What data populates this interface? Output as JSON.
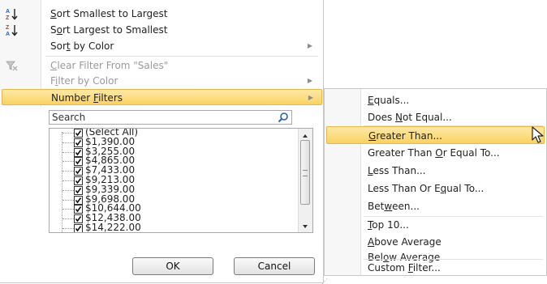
{
  "menu": {
    "sort_asc": {
      "pre": "",
      "ul": "S",
      "post": "ort Smallest to Largest"
    },
    "sort_desc": {
      "pre": "S",
      "ul": "o",
      "post": "rt Largest to Smallest"
    },
    "sort_color": {
      "pre": "Sor",
      "ul": "t",
      "post": " by Color"
    },
    "clear_filter": {
      "pre": "",
      "ul": "C",
      "post": "lear Filter From \"Sales\""
    },
    "filter_color": {
      "pre": "F",
      "ul": "i",
      "post": "lter by Color"
    },
    "number_filters": {
      "pre": "Number ",
      "ul": "F",
      "post": "ilters"
    }
  },
  "search": {
    "placeholder": "Search",
    "value": ""
  },
  "checklist": {
    "items": [
      {
        "label": "(Select All)",
        "checked": true
      },
      {
        "label": "$1,390.00",
        "checked": true
      },
      {
        "label": "$3,255.00",
        "checked": true
      },
      {
        "label": "$4,865.00",
        "checked": true
      },
      {
        "label": "$7,433.00",
        "checked": true
      },
      {
        "label": "$9,213.00",
        "checked": true
      },
      {
        "label": "$9,339.00",
        "checked": true
      },
      {
        "label": "$9,698.00",
        "checked": true
      },
      {
        "label": "$10,644.00",
        "checked": true
      },
      {
        "label": "$12,438.00",
        "checked": true
      },
      {
        "label": "$14,222.00",
        "checked": true
      }
    ]
  },
  "buttons": {
    "ok": "OK",
    "cancel": "Cancel"
  },
  "submenu": {
    "equals": {
      "pre": "",
      "ul": "E",
      "post": "quals..."
    },
    "not_equal": {
      "pre": "Does ",
      "ul": "N",
      "post": "ot Equal..."
    },
    "greater_than": {
      "pre": "",
      "ul": "G",
      "post": "reater Than..."
    },
    "greater_equal": {
      "pre": "Greater Than ",
      "ul": "O",
      "post": "r Equal To..."
    },
    "less_than": {
      "pre": "",
      "ul": "L",
      "post": "ess Than..."
    },
    "less_equal": {
      "pre": "Less Than Or E",
      "ul": "q",
      "post": "ual To..."
    },
    "between": {
      "pre": "Bet",
      "ul": "w",
      "post": "een..."
    },
    "top10": {
      "pre": "",
      "ul": "T",
      "post": "op 10..."
    },
    "above_avg": {
      "pre": "",
      "ul": "A",
      "post": "bove Average"
    },
    "below_avg": {
      "pre": "Bel",
      "ul": "o",
      "post": "w Average"
    },
    "custom": {
      "pre": "Custom ",
      "ul": "F",
      "post": "ilter..."
    }
  },
  "colors": {
    "highlight_top": "#fde9a6",
    "highlight_bottom": "#f9d262",
    "highlight_border": "#e6b84b",
    "sort_blue": "#2b5fb4",
    "sort_red": "#c0392b",
    "disabled_text": "#9a9a9a"
  },
  "icons": {
    "sort_asc": "sort-a-to-z-icon",
    "sort_desc": "sort-z-to-a-icon",
    "clear_filter": "clear-filter-icon",
    "search": "magnifier-icon",
    "cursor": "mouse-pointer-icon"
  }
}
